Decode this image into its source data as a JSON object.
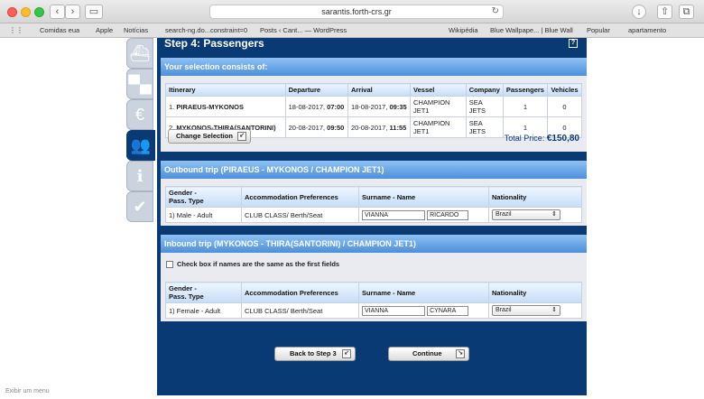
{
  "browser": {
    "url": "sarantis.forth-crs.gr",
    "bookmarks": [
      "Comidas eua",
      "Apple",
      "Notícias",
      "search-ng.do...constraint=0",
      "Posts ‹ Cant... — WordPress",
      "Wikipédia",
      "Blue Wallpape... | Blue Wall",
      "Popular",
      "apartamento"
    ],
    "status": "Exibir um menu"
  },
  "step": {
    "title": "Step 4: Passengers",
    "help": "?"
  },
  "selection": {
    "heading": "Your selection consists of:",
    "columns": [
      "Itinerary",
      "Departure",
      "Arrival",
      "Vessel",
      "Company",
      "Passengers",
      "Vehicles"
    ],
    "rows": [
      {
        "itinerary_num": "1.",
        "itinerary": "PIRAEUS-MYKONOS",
        "dep_date": "18-08-2017,",
        "dep_time": "07:00",
        "arr_date": "18-08-2017,",
        "arr_time": "09:35",
        "vessel": "CHAMPION JET1",
        "company": "SEA JETS",
        "passengers": "1",
        "vehicles": "0"
      },
      {
        "itinerary_num": "2.",
        "itinerary": "MYKONOS-THIRA(SANTORINI)",
        "dep_date": "20-08-2017,",
        "dep_time": "09:50",
        "arr_date": "20-08-2017,",
        "arr_time": "11:55",
        "vessel": "CHAMPION JET1",
        "company": "SEA JETS",
        "passengers": "1",
        "vehicles": "0"
      }
    ],
    "change_button": "Change Selection",
    "total_label": "Total Price:",
    "total_value": "€150,80"
  },
  "outbound": {
    "heading": "Outbound trip (PIRAEUS - MYKONOS / CHAMPION JET1)",
    "columns": {
      "gender": "Gender -",
      "pass_type": "Pass. Type",
      "accommodation": "Accommodation Preferences",
      "surname_name": "Surname - Name",
      "nationality": "Nationality"
    },
    "passenger": {
      "label": "1) Male - Adult",
      "accommodation": "CLUB CLASS/ Berth/Seat",
      "surname": "VIANNA",
      "name": "RICARDO",
      "nationality": "Brazil"
    }
  },
  "inbound": {
    "heading": "Inbound trip (MYKONOS - THIRA(SANTORINI) / CHAMPION JET1)",
    "same_names_label": "Check box if names are the same as the first fields",
    "columns": {
      "gender": "Gender -",
      "pass_type": "Pass. Type",
      "accommodation": "Accommodation Preferences",
      "surname_name": "Surname - Name",
      "nationality": "Nationality"
    },
    "passenger": {
      "label": "1) Female - Adult",
      "accommodation": "CLUB CLASS/ Berth/Seat",
      "surname": "VIANNA",
      "name": "CYNARA",
      "nationality": "Brazil"
    }
  },
  "footer": {
    "back_button": "Back to Step 3",
    "continue_button": "Continue"
  },
  "colors": {
    "navy": "#0a3a73",
    "header_blue": "#4c8fda"
  }
}
